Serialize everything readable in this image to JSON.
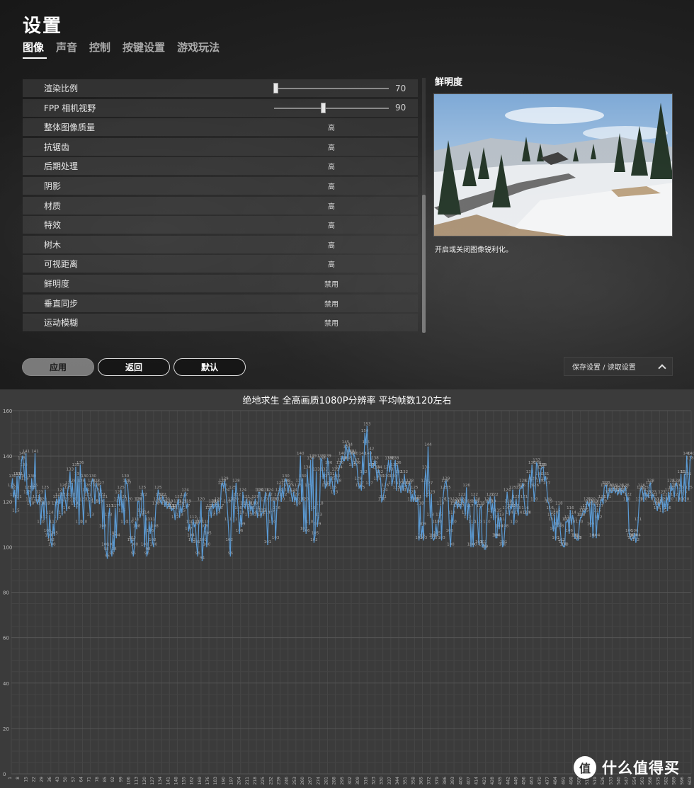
{
  "page_title": "设置",
  "tabs": [
    {
      "label": "图像",
      "active": true
    },
    {
      "label": "声音",
      "active": false
    },
    {
      "label": "控制",
      "active": false
    },
    {
      "label": "按键设置",
      "active": false
    },
    {
      "label": "游戏玩法",
      "active": false
    }
  ],
  "settings": [
    {
      "label": "渲染比例",
      "type": "slider",
      "value": "70",
      "fraction": 0.0
    },
    {
      "label": "FPP 相机视野",
      "type": "slider",
      "value": "90",
      "fraction": 0.43
    },
    {
      "label": "整体图像质量",
      "type": "option",
      "value": "高"
    },
    {
      "label": "抗锯齿",
      "type": "option",
      "value": "高"
    },
    {
      "label": "后期处理",
      "type": "option",
      "value": "高"
    },
    {
      "label": "阴影",
      "type": "option",
      "value": "高"
    },
    {
      "label": "材质",
      "type": "option",
      "value": "高"
    },
    {
      "label": "特效",
      "type": "option",
      "value": "高"
    },
    {
      "label": "树木",
      "type": "option",
      "value": "高"
    },
    {
      "label": "可视距离",
      "type": "option",
      "value": "高"
    },
    {
      "label": "鲜明度",
      "type": "option",
      "value": "禁用"
    },
    {
      "label": "垂直同步",
      "type": "option",
      "value": "禁用"
    },
    {
      "label": "运动模糊",
      "type": "option",
      "value": "禁用"
    }
  ],
  "preview": {
    "title": "鲜明度",
    "description": "开启或关闭图像锐利化。"
  },
  "buttons": {
    "apply": "应用",
    "back": "返回",
    "default": "默认",
    "save_load": "保存设置 / 读取设置"
  },
  "chart_data": {
    "type": "line",
    "title": "绝地求生 全高画质1080P分辨率 平均帧数120左右",
    "xlabel": "",
    "ylabel": "",
    "ylim": [
      0,
      160
    ],
    "yticks": [
      0,
      20,
      40,
      60,
      80,
      100,
      120,
      140,
      160
    ],
    "xticks": [
      1,
      8,
      15,
      22,
      29,
      36,
      43,
      50,
      57,
      64,
      71,
      78,
      85,
      92,
      99,
      106,
      113,
      120,
      127,
      134,
      141,
      148,
      155,
      162,
      169,
      176,
      183,
      190,
      197,
      204,
      211,
      218,
      225,
      232,
      239,
      246,
      253,
      260,
      267,
      274,
      281,
      288,
      295,
      302,
      309,
      316,
      323,
      330,
      337,
      344,
      351,
      358,
      365,
      372,
      379,
      386,
      393,
      400,
      407,
      414,
      421,
      428,
      435,
      442,
      449,
      456,
      463,
      470,
      477,
      484,
      491,
      498,
      505,
      512,
      519,
      526,
      533,
      540,
      547,
      554,
      561,
      568,
      575,
      582,
      589,
      596,
      603,
      610,
      617,
      624,
      631,
      638
    ],
    "grid": true,
    "series": [
      {
        "color": "#5b9bd5",
        "x_start": 1,
        "values": [
          126,
          130,
          122,
          125,
          115,
          131,
          121,
          131,
          130,
          138,
          140,
          135,
          129,
          141,
          123,
          125,
          120,
          118,
          130,
          125,
          126,
          141,
          121,
          119,
          120,
          123,
          110,
          118,
          120,
          112,
          125,
          118,
          106,
          104,
          114,
          102,
          100,
          110,
          105,
          118,
          121,
          112,
          122,
          119,
          124,
          114,
          126,
          122,
          120,
          116,
          125,
          127,
          133,
          122,
          128,
          120,
          118,
          135,
          117,
          131,
          110,
          136,
          128,
          120,
          110,
          130,
          124,
          126,
          122,
          120,
          113,
          128,
          130,
          127,
          119,
          128,
          126,
          124,
          119,
          127,
          122,
          108,
          121,
          100,
          98,
          95,
          113,
          117,
          100,
          96,
          105,
          98,
          117,
          104,
          120,
          123,
          118,
          125,
          115,
          121,
          110,
          130,
          128,
          127,
          120,
          110,
          102,
          103,
          96,
          100,
          111,
          108,
          120,
          120,
          113,
          115,
          125,
          122,
          100,
          114,
          96,
          98,
          111,
          106,
          111,
          102,
          100,
          108,
          118,
          120,
          125,
          122,
          120,
          119,
          122,
          121,
          118,
          120,
          117,
          118,
          119,
          117,
          116,
          117,
          116,
          112,
          117,
          119,
          121,
          113,
          118,
          115,
          119,
          122,
          124,
          117,
          119,
          107,
          110,
          104,
          102,
          112,
          109,
          110,
          101,
          96,
          110,
          111,
          120,
          94,
          102,
          108,
          110,
          100,
          105,
          116,
          117,
          113,
          119,
          117,
          118,
          119,
          114,
          120,
          116,
          117,
          127,
          128,
          126,
          129,
          124,
          119,
          111,
          102,
          96,
          120,
          125,
          111,
          120,
          128,
          122,
          116,
          106,
          114,
          109,
          124,
          118,
          117,
          121,
          118,
          113,
          120,
          116,
          118,
          114,
          118,
          121,
          116,
          113,
          124,
          124,
          113,
          115,
          115,
          120,
          124,
          114,
          101,
          122,
          124,
          115,
          110,
          120,
          120,
          103,
          116,
          122,
          124,
          127,
          120,
          126,
          122,
          128,
          130,
          128,
          124,
          127,
          126,
          123,
          120,
          124,
          120,
          122,
          118,
          126,
          128,
          140,
          120,
          130,
          107,
          120,
          106,
          134,
          126,
          110,
          138,
          116,
          139,
          102,
          105,
          133,
          109,
          113,
          118,
          139,
          138,
          130,
          133,
          126,
          127,
          139,
          136,
          127,
          131,
          129,
          125,
          123,
          133,
          130,
          128,
          134,
          136,
          137,
          140,
          138,
          138,
          145,
          143,
          138,
          144,
          141,
          140,
          135,
          141,
          140,
          137,
          136,
          129,
          126,
          127,
          125,
          140,
          132,
          150,
          145,
          153,
          140,
          127,
          142,
          135,
          135,
          136,
          138,
          134,
          129,
          134,
          132,
          130,
          120,
          121,
          124,
          126,
          130,
          134,
          138,
          133,
          138,
          127,
          130,
          135,
          138,
          125,
          136,
          132,
          127,
          124,
          128,
          125,
          132,
          127,
          127,
          124,
          127,
          128,
          120,
          123,
          120,
          125,
          120,
          120,
          121,
          103,
          118,
          104,
          109,
          103,
          128,
          134,
          122,
          144,
          127,
          113,
          123,
          104,
          103,
          104,
          110,
          105,
          110,
          113,
          118,
          103,
          120,
          125,
          128,
          129,
          125,
          120,
          106,
          100,
          114,
          110,
          118,
          119,
          120,
          117,
          119,
          118,
          117,
          122,
          120,
          119,
          114,
          126,
          112,
          119,
          117,
          100,
          110,
          100,
          122,
          119,
          120,
          110,
          101,
          117,
          118,
          100,
          101,
          99,
          99,
          110,
          120,
          119,
          122,
          115,
          119,
          112,
          122,
          104,
          104,
          115,
          108,
          113,
          111,
          100,
          101,
          108,
          116,
          124,
          119,
          114,
          118,
          117,
          125,
          110,
          117,
          121,
          116,
          114,
          125,
          126,
          126,
          128,
          121,
          116,
          114,
          114,
          128,
          132,
          126,
          136,
          129,
          120,
          126,
          137,
          136,
          131,
          128,
          134,
          135,
          135,
          129,
          131,
          127,
          120,
          119,
          116,
          113,
          111,
          107,
          114,
          103,
          115,
          109,
          118,
          108,
          102,
          101,
          100,
          100,
          111,
          111,
          112,
          106,
          116,
          110,
          114,
          111,
          104,
          104,
          103,
          103,
          110,
          113,
          113,
          115,
          116,
          115,
          117,
          120,
          118,
          119,
          109,
          120,
          104,
          119,
          118,
          104,
          115,
          112,
          117,
          120,
          121,
          119,
          126,
          127,
          127,
          121,
          123,
          126,
          124,
          124,
          126,
          125,
          124,
          125,
          123,
          124,
          126,
          123,
          125,
          124,
          125,
          126,
          120,
          122,
          106,
          104,
          103,
          104,
          104,
          106,
          102,
          104,
          111,
          120,
          125,
          126,
          124,
          120,
          125,
          122,
          123,
          122,
          127,
          128,
          121,
          123,
          122,
          120,
          118,
          116,
          119,
          118,
          120,
          123,
          115,
          120,
          117,
          122,
          116,
          124,
          120,
          128,
          125,
          126,
          122,
          127,
          128,
          126,
          120,
          125,
          132,
          120,
          123,
          132,
          120,
          140,
          131,
          125,
          138,
          140
        ]
      }
    ]
  },
  "watermark": {
    "logo": "值",
    "text": "什么值得买"
  }
}
